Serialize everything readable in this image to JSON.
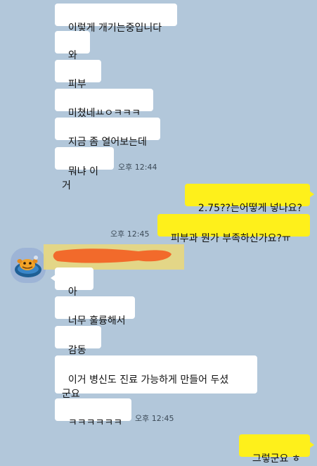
{
  "messages": [
    {
      "text": "이렇게 개기는중입니다"
    },
    {
      "text": "와씨"
    },
    {
      "text": "피부과"
    },
    {
      "text": "미쳤네ㅛㅇㅋㅋㅋ"
    },
    {
      "text": "지금 좀 열어보는데"
    },
    {
      "text": "뭐냐 이거"
    },
    {
      "text": "2.75??는어떻게 넣나요?"
    },
    {
      "text": "피부과 뭔가 부족하신가요?ㅠ"
    },
    {
      "text": "아뇨.."
    },
    {
      "text": "너무 훌륭해서"
    },
    {
      "text": "감동중"
    },
    {
      "text": "이거 병신도 진료 가능하게 만들어 두셨\n군요"
    },
    {
      "text": "ㅋㅋㅋㅋㅋㅋ"
    },
    {
      "text": "그렇군요 ㅎ"
    }
  ],
  "timestamps": {
    "t1": "오후 12:44",
    "t2": "오후 12:45",
    "t3": "오후 12:45"
  },
  "colors": {
    "background": "#b2c7da",
    "received_bubble": "#ffffff",
    "sent_bubble": "#fef01b",
    "redaction_mark": "#f26a2b",
    "redaction_highlight": "#e8d77d"
  },
  "icons": {
    "avatar": "cartoon-character-avatar"
  }
}
